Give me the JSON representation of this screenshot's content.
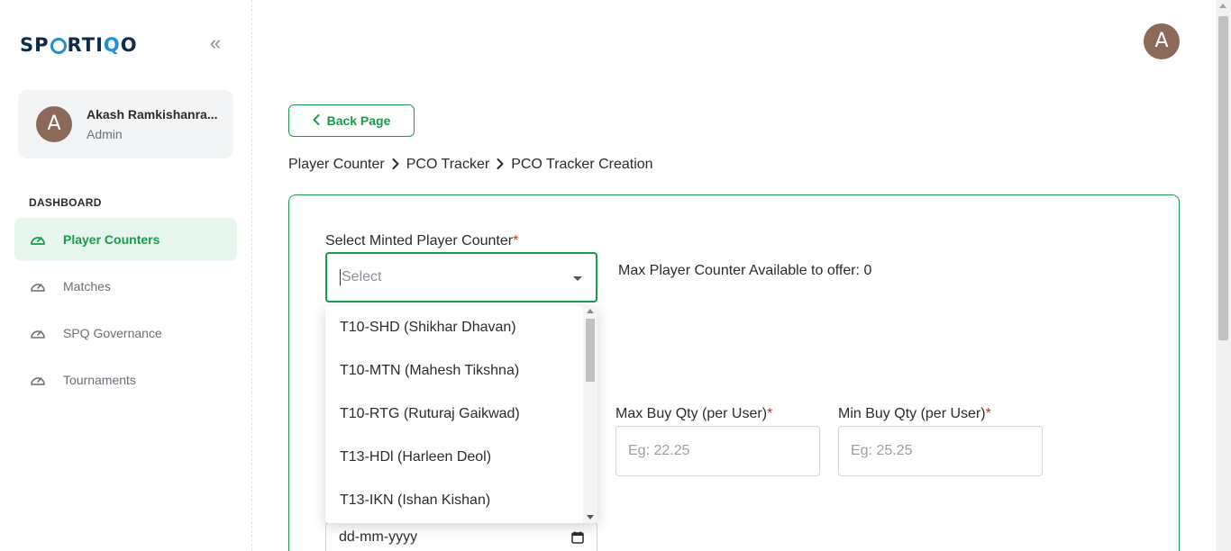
{
  "brand": {
    "logo_text_pre": "SP",
    "logo_text_mid": "RTI",
    "logo_text_q": "Q",
    "logo_text_end": "O"
  },
  "user": {
    "initial": "A",
    "name": "Akash Ramkishanra...",
    "role": "Admin"
  },
  "sidebar": {
    "section_label": "DASHBOARD",
    "items": [
      {
        "label": "Player Counters",
        "active": true
      },
      {
        "label": "Matches",
        "active": false
      },
      {
        "label": "SPQ Governance",
        "active": false
      },
      {
        "label": "Tournaments",
        "active": false
      }
    ]
  },
  "header": {
    "avatar_initial": "A"
  },
  "back_button": {
    "label": "Back Page"
  },
  "breadcrumb": {
    "items": [
      "Player Counter",
      "PCO Tracker",
      "PCO Tracker Creation"
    ]
  },
  "form": {
    "select_label": "Select Minted Player Counter",
    "required_mark": "*",
    "select_placeholder": "Select",
    "max_available_text": "Max Player Counter Available to offer: 0",
    "max_buy_label": "Max Buy Qty (per User)",
    "max_buy_placeholder": "Eg: 22.25",
    "min_buy_label": "Min Buy Qty (per User)",
    "min_buy_placeholder": "Eg: 25.25",
    "date_value": "dd-mm-yyyy"
  },
  "dropdown": {
    "options": [
      "T10-SHD (Shikhar Dhavan)",
      "T10-MTN (Mahesh Tikshna)",
      "T10-RTG (Ruturaj Gaikwad)",
      "T13-HDl (Harleen Deol)",
      "T13-IKN (Ishan Kishan)"
    ]
  },
  "colors": {
    "accent": "#1a9a4a",
    "active_bg": "#e7f6ec",
    "avatar": "#8b6a5a",
    "brand_dark": "#0f2b4b",
    "brand_blue": "#1f8fd8",
    "required": "#e02424"
  }
}
